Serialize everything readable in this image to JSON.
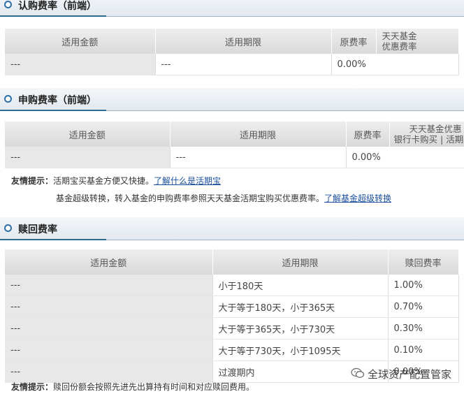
{
  "s1": {
    "title": "认购费率（前端）",
    "headers": [
      "适用金额",
      "适用期限",
      "原费率",
      "天天基金",
      "优惠费率"
    ],
    "row": [
      "---",
      "---",
      "0.00%"
    ]
  },
  "s2": {
    "title": "申购费率（前端）",
    "headers": [
      "适用金额",
      "适用期限",
      "原费率",
      "天天基金优惠",
      "银行卡购买",
      "活期"
    ],
    "row": [
      "---",
      "---",
      "0.00%"
    ],
    "tip1_label": "友情提示：",
    "tip1_text": "活期宝买基金方便又快捷。",
    "tip1_link": "了解什么是活期宝",
    "tip2_text": "基金超级转换，转入基金的申购费率参照天天基金活期宝购买优惠费率。",
    "tip2_link": "了解基金超级转换"
  },
  "s3": {
    "title": "赎回费率",
    "headers": [
      "适用金额",
      "适用期限",
      "赎回费率"
    ],
    "rows": [
      [
        "---",
        "小于180天",
        "1.00%"
      ],
      [
        "---",
        "大于等于180天，小于365天",
        "0.70%"
      ],
      [
        "---",
        "大于等于365天，小于730天",
        "0.30%"
      ],
      [
        "---",
        "大于等于730天，小于1095天",
        "0.10%"
      ],
      [
        "---",
        "过渡期内",
        "0.00%"
      ]
    ],
    "tip_label": "友情提示：",
    "tip_text": "赎回份额会按照先进先出算持有时间和对应赎回费用。"
  },
  "watermark": {
    "icon": "wechat-icon",
    "text": "全球资产配置管家"
  }
}
